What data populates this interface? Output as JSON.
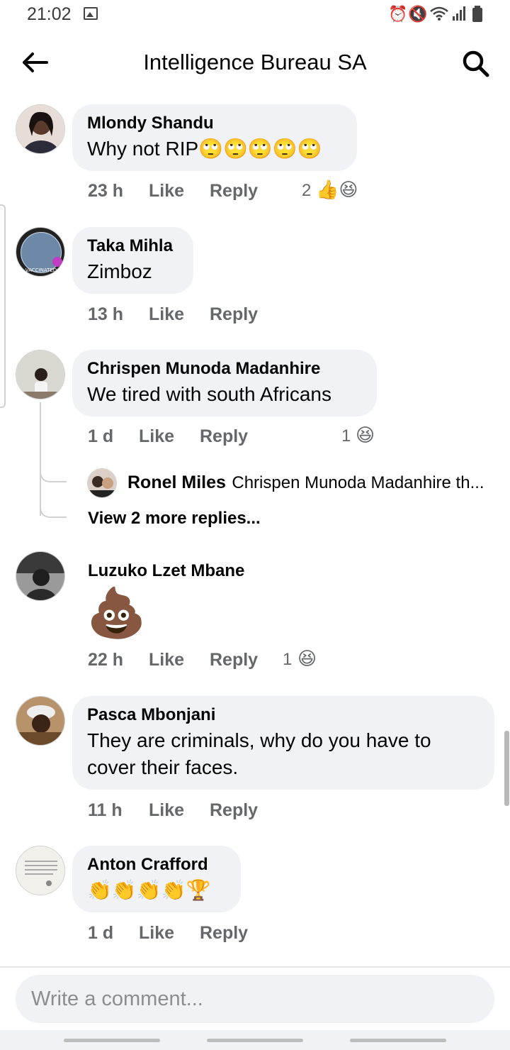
{
  "status": {
    "time": "21:02"
  },
  "header": {
    "title": "Intelligence Bureau SA"
  },
  "comments": [
    {
      "name": "Mlondy Shandu",
      "text": "Why not RIP🙄🙄🙄🙄🙄",
      "time": "23 h",
      "like": "Like",
      "reply": "Reply",
      "reaction_count": "2",
      "reactions": "👍😆"
    },
    {
      "name": "Taka Mihla",
      "text": "Zimboz",
      "time": "13 h",
      "like": "Like",
      "reply": "Reply"
    },
    {
      "name": "Chrispen Munoda Madanhire",
      "text": "We tired with south Africans",
      "time": "1 d",
      "like": "Like",
      "reply": "Reply",
      "reaction_count": "1",
      "reactions": "😆",
      "reply_preview": {
        "name": "Ronel Miles",
        "text": "Chrispen Munoda Madanhire th..."
      },
      "view_more": "View 2 more replies..."
    },
    {
      "name": "Luzuko Lzet Mbane",
      "text": "💩",
      "time": "22 h",
      "like": "Like",
      "reply": "Reply",
      "reaction_count": "1",
      "reactions": "😆"
    },
    {
      "name": "Pasca Mbonjani",
      "text": "They are criminals, why do you have to cover their faces.",
      "time": "11 h",
      "like": "Like",
      "reply": "Reply"
    },
    {
      "name": "Anton Crafford",
      "text": "👏👏👏👏🏆",
      "time": "1 d",
      "like": "Like",
      "reply": "Reply"
    }
  ],
  "composer": {
    "placeholder": "Write a comment..."
  },
  "colors": {
    "bubble": "#f0f2f5",
    "meta": "#65676b",
    "like_blue": "#1877f2",
    "haha_yellow": "#f7b125"
  }
}
